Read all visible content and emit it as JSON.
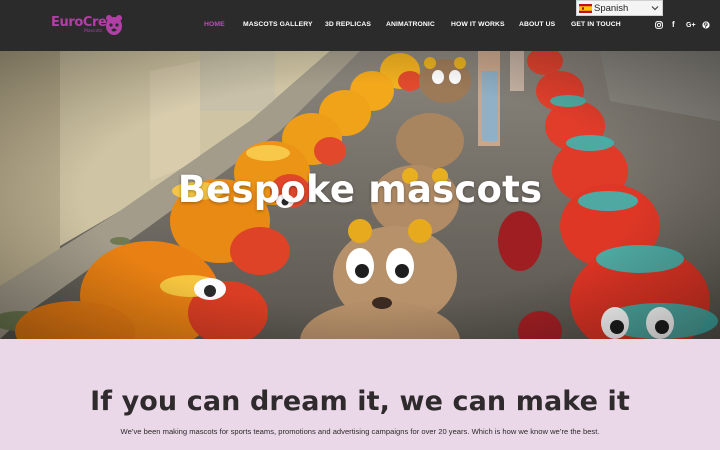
{
  "header": {
    "logo_text": "EuroCrea",
    "logo_subtext": "Mascots",
    "nav": [
      {
        "label": "HOME",
        "active": true
      },
      {
        "label": "MASCOTS GALLERY",
        "active": false
      },
      {
        "label": "3D REPLICAS",
        "active": false
      },
      {
        "label": "ANIMATRONIC",
        "active": false
      },
      {
        "label": "HOW IT WORKS",
        "active": false
      },
      {
        "label": "ABOUT US",
        "active": false
      },
      {
        "label": "GET IN TOUCH",
        "active": false
      }
    ],
    "social_icons": [
      "instagram-icon",
      "facebook-icon",
      "google-plus-icon",
      "pinterest-icon"
    ],
    "social_glyphs": {
      "facebook": "f",
      "google_plus": "G+"
    },
    "language": {
      "label": "Spanish",
      "flag": "spain-flag-icon"
    }
  },
  "hero": {
    "title": "Bespoke mascots"
  },
  "intro": {
    "title": "If you can dream it, we can make it",
    "text": "We’ve been making mascots for sports teams, promotions and advertising campaigns for over 20 years. Which is how we know we’re the best."
  },
  "colors": {
    "header_bg": "#2c2b2c",
    "accent": "#c04bb6",
    "content_bg": "#ead7e8",
    "text_dark": "#2f2a2c"
  }
}
